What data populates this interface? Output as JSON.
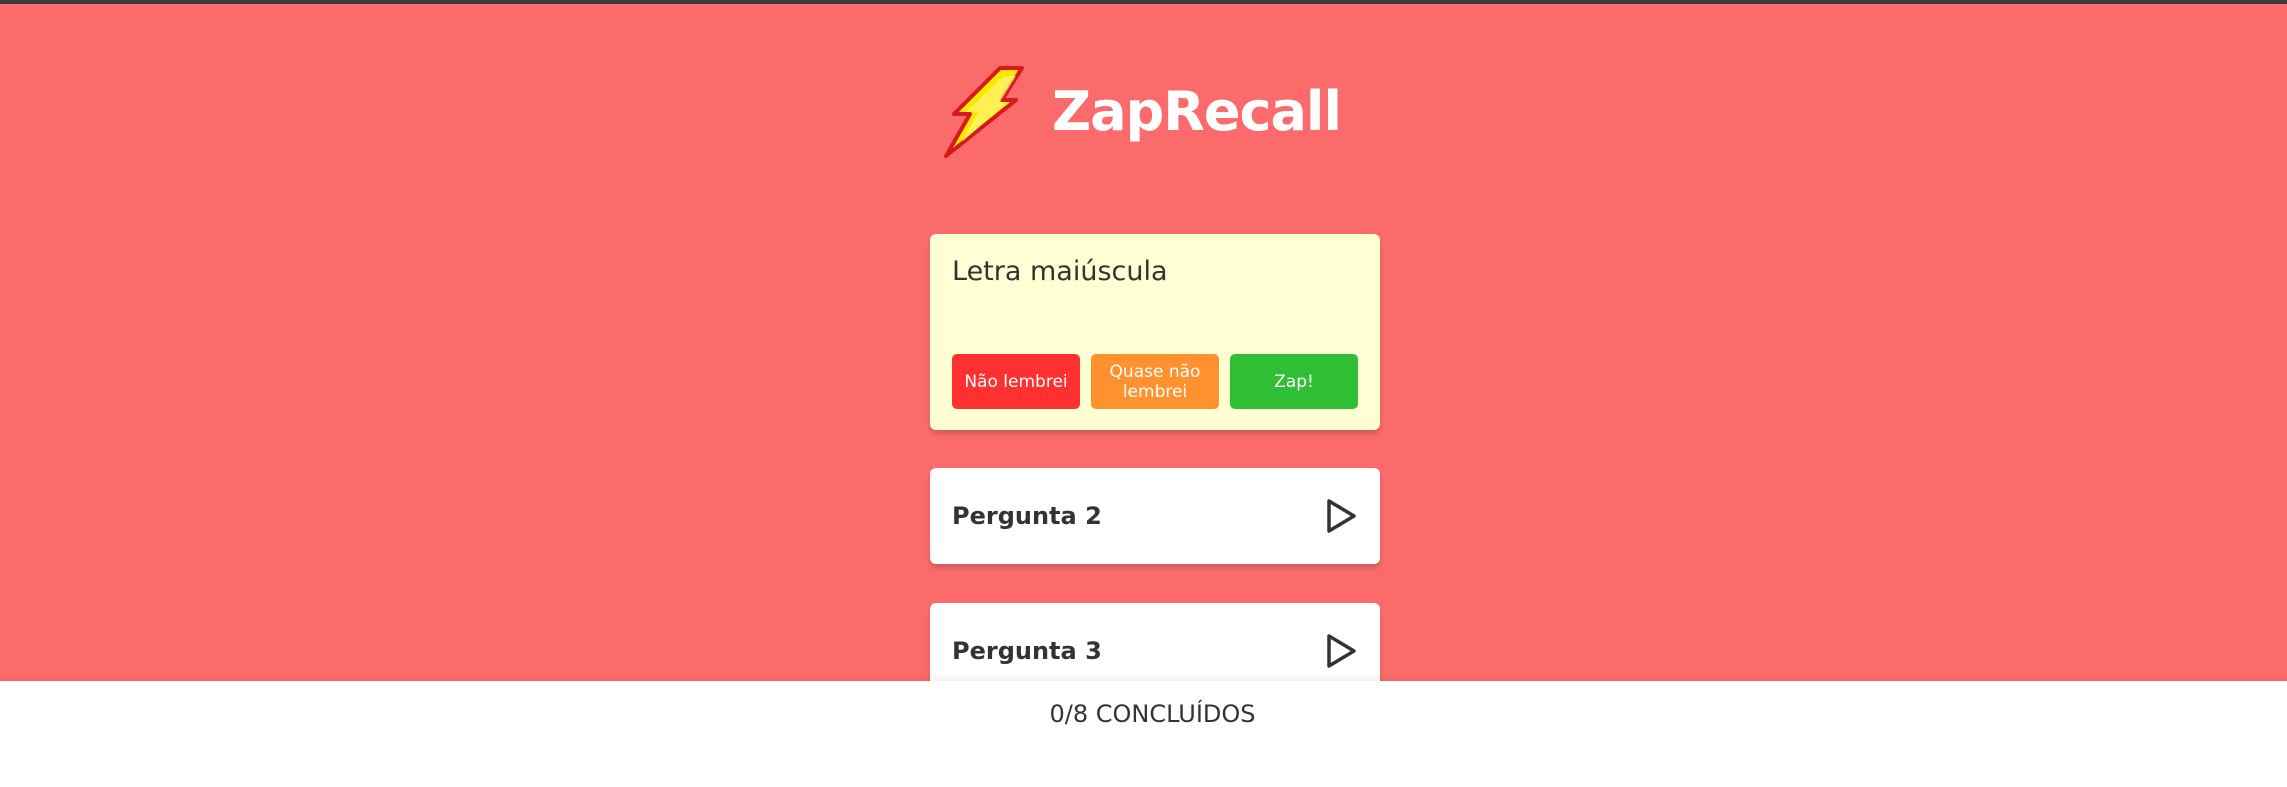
{
  "header": {
    "title": "ZapRecall",
    "logo_icon": "lightning-icon"
  },
  "cards": {
    "open": {
      "answer": "Letra maiúscula",
      "buttons": {
        "forgot": "Não lembrei",
        "almost": "Quase não lembrei",
        "zap": "Zap!"
      }
    },
    "closed": [
      {
        "label": "Pergunta 2",
        "icon": "play-icon"
      },
      {
        "label": "Pergunta 3",
        "icon": "play-icon"
      }
    ]
  },
  "footer": {
    "progress": "0/8 CONCLUÍDOS"
  },
  "colors": {
    "background": "#FB6B6B",
    "open_card": "#FFFFD4",
    "forgot": "#FF3030",
    "almost": "#FF922E",
    "zap": "#2FBE34"
  }
}
